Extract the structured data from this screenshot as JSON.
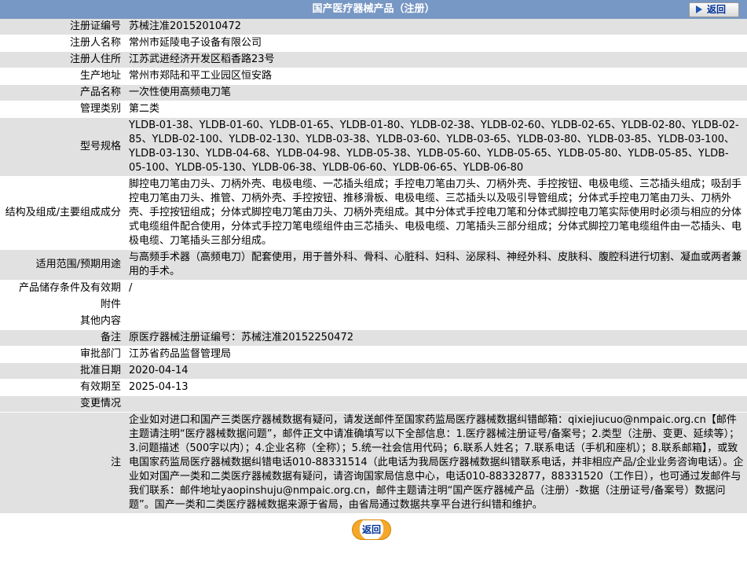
{
  "header": {
    "title": "国产医疗器械产品（注册）",
    "back_label": "返回"
  },
  "fields": [
    {
      "label": "注册证编号",
      "value": "苏械注准20152010472"
    },
    {
      "label": "注册人名称",
      "value": "常州市延陵电子设备有限公司"
    },
    {
      "label": "注册人住所",
      "value": "江苏武进经济开发区稻香路23号"
    },
    {
      "label": "生产地址",
      "value": "常州市郑陆和平工业园区恒安路"
    },
    {
      "label": "产品名称",
      "value": "一次性使用高频电刀笔"
    },
    {
      "label": "管理类别",
      "value": "第二类"
    },
    {
      "label": "型号规格",
      "value": "YLDB-01-38、YLDB-01-60、YLDB-01-65、YLDB-01-80、YLDB-02-38、YLDB-02-60、YLDB-02-65、YLDB-02-80、YLDB-02-85、YLDB-02-100、YLDB-02-130、YLDB-03-38、YLDB-03-60、YLDB-03-65、YLDB-03-80、YLDB-03-85、YLDB-03-100、YLDB-03-130、YLDB-04-68、YLDB-04-98、YLDB-05-38、YLDB-05-60、YLDB-05-65、YLDB-05-80、YLDB-05-85、YLDB-05-100、YLDB-05-130、YLDB-06-38、YLDB-06-60、YLDB-06-65、YLDB-06-80"
    },
    {
      "label": "结构及组成/主要组成成分",
      "value": "脚控电刀笔由刀头、刀柄外壳、电极电缆、一芯插头组成；手控电刀笔由刀头、刀柄外壳、手控按钮、电极电缆、三芯插头组成；吸刮手控电刀笔由刀头、推管、刀柄外壳、手控按钮、推移滑板、电极电缆、三芯插头以及吸引导管组成；分体式手控电刀笔由刀头、刀柄外壳、手控按钮组成；分体式脚控电刀笔由刀头、刀柄外壳组成。其中分体式手控电刀笔和分体式脚控电刀笔实际使用时必须与相应的分体式电缆组件配合使用，分体式手控刀笔电缆组件由三芯插头、电极电缆、刀笔插头三部分组成；分体式脚控刀笔电缆组件由一芯插头、电极电缆、刀笔插头三部分组成。"
    },
    {
      "label": "适用范围/预期用途",
      "value": "与高频手术器（高频电刀）配套使用，用于普外科、骨科、心脏科、妇科、泌尿科、神经外科、皮肤科、腹腔科进行切割、凝血或两者兼用的手术。"
    },
    {
      "label": "产品储存条件及有效期",
      "value": "/"
    },
    {
      "label": "附件",
      "value": ""
    },
    {
      "label": "其他内容",
      "value": ""
    },
    {
      "label": "备注",
      "value": "原医疗器械注册证编号：苏械注准20152250472"
    },
    {
      "label": "审批部门",
      "value": "江苏省药品监督管理局"
    },
    {
      "label": "批准日期",
      "value": "2020-04-14"
    },
    {
      "label": "有效期至",
      "value": "2025-04-13"
    },
    {
      "label": "变更情况",
      "value": ""
    },
    {
      "label": "注",
      "value": "企业如对进口和国产三类医疗器械数据有疑问，请发送邮件至国家药监局医疗器械数据纠错邮箱：qixiejiucuo@nmpaic.org.cn【邮件主题请注明“医疗器械数据问题”，邮件正文中请准确填写以下全部信息：1.医疗器械注册证号/备案号；2.类型（注册、变更、延续等）；3.问题描述（500字以内）；4.企业名称（全称）；5.统一社会信用代码；6.联系人姓名；7.联系电话（手机和座机）；8.联系邮箱】，或致电国家药监局医疗器械数据纠错电话010-88331514（此电话为我局医疗器械数据纠错联系电话，并非相应产品/企业业务咨询电话）。企业如对国产一类和二类医疗器械数据有疑问，请咨询国家局信息中心，电话010-88332877，88331520（工作日），也可通过发邮件与我们联系：邮件地址yaopinshuju@nmpaic.org.cn，邮件主题请注明“国产医疗器械产品（注册）-数据（注册证号/备案号）数据问题”。国产一类和二类医疗器械数据来源于省局，由省局通过数据共享平台进行纠错和维护。"
    }
  ]
}
